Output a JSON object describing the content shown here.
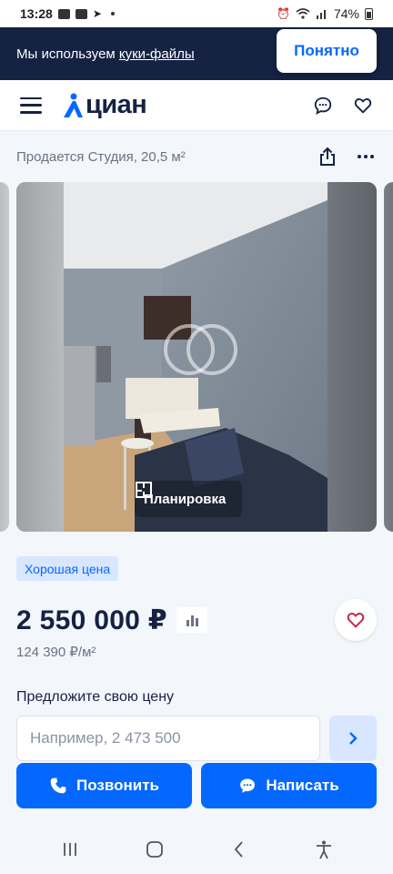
{
  "status_bar": {
    "time": "13:28",
    "battery": "74%"
  },
  "cookie_banner": {
    "text": "Мы используем ",
    "link": "куки-файлы",
    "button": "Понятно"
  },
  "header": {
    "logo_text": "циан",
    "icons": [
      "menu-icon",
      "chat-icon",
      "heart-icon"
    ]
  },
  "listing": {
    "title": "Продается Студия, 20,5 м²",
    "plan_button": "Планировка",
    "badge": "Хорошая цена",
    "price": "2 550 000 ₽",
    "price_per_sqm": "124 390 ₽/м²",
    "offer_label": "Предложите свою цену",
    "offer_placeholder": "Например, 2 473 500"
  },
  "actions": {
    "call": "Позвонить",
    "message": "Написать"
  },
  "colors": {
    "accent": "#0468ff",
    "dark": "#152242",
    "muted": "#6a7283",
    "background": "#f3f6fb"
  }
}
